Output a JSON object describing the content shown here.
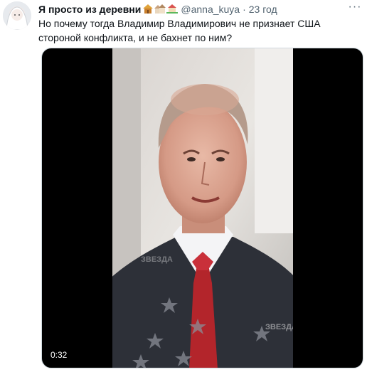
{
  "tweet": {
    "display_name": "Я просто из деревни",
    "emoji_icons": [
      "hut-icon",
      "houses-icon",
      "house-with-garden-icon"
    ],
    "handle": "@anna_kuya",
    "separator": "·",
    "time": "23 год",
    "more_label": "···",
    "text": "Но почему тогда Владимир Владимирович не признает США стороной конфликта, и не бахнет по ним?"
  },
  "media": {
    "type": "video",
    "duration": "0:32",
    "watermark": "ЗВЕЗДА"
  }
}
